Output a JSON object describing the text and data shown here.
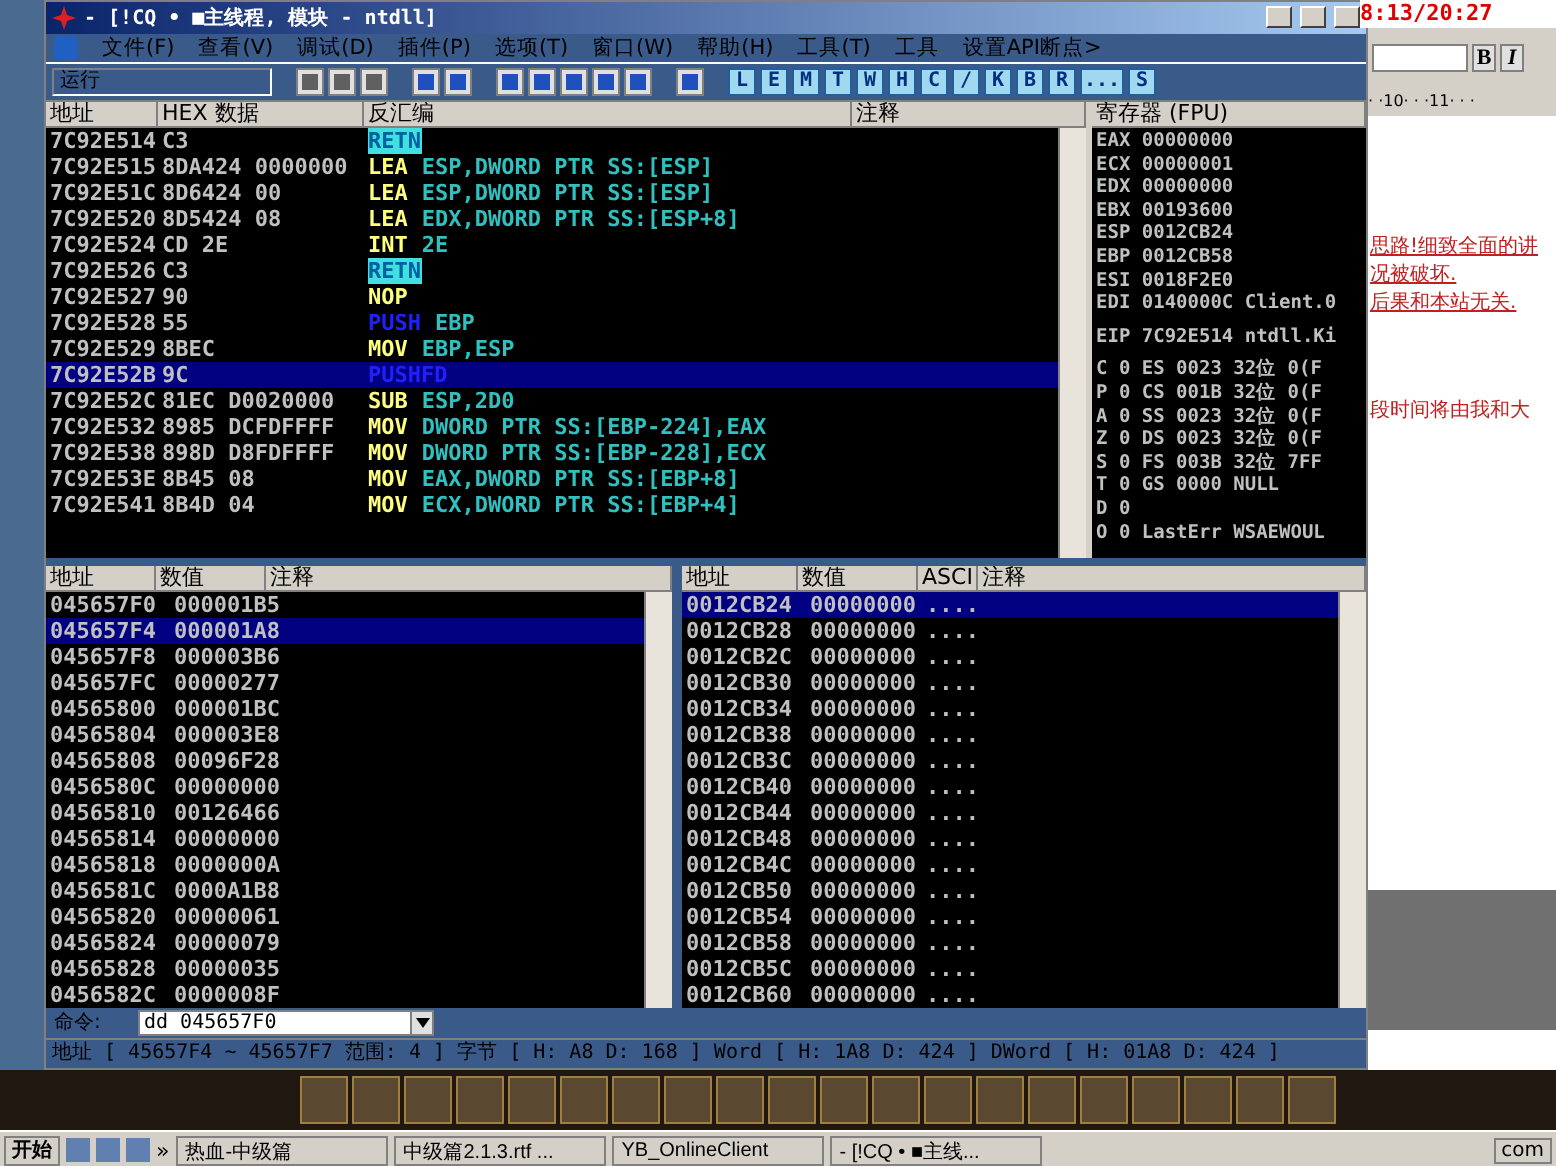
{
  "window": {
    "title": "- [!CQ • ■主线程, 模块 - ntdll]"
  },
  "menu": [
    "文件(F)",
    "查看(V)",
    "调试(D)",
    "插件(P)",
    "选项(T)",
    "窗口(W)",
    "帮助(H)",
    "工具(T)",
    "工具",
    "设置API断点>"
  ],
  "toolbar": {
    "status": "运行",
    "letters": [
      "L",
      "E",
      "M",
      "T",
      "W",
      "H",
      "C",
      "/",
      "K",
      "B",
      "R",
      "...",
      "S"
    ]
  },
  "disasm": {
    "columns": [
      "地址",
      "HEX 数据",
      "反汇编",
      "注释"
    ],
    "rows": [
      {
        "address": "7C92E514",
        "hex": "C3",
        "kind": "ret",
        "mnemonic": "RETN",
        "operands": "",
        "selected": false
      },
      {
        "address": "7C92E515",
        "hex": "8DA424 0000000",
        "kind": "op",
        "mnemonic": "LEA",
        "operands": "ESP,DWORD PTR SS:[ESP]",
        "selected": false
      },
      {
        "address": "7C92E51C",
        "hex": "8D6424 00",
        "kind": "op",
        "mnemonic": "LEA",
        "operands": "ESP,DWORD PTR SS:[ESP]",
        "selected": false
      },
      {
        "address": "7C92E520",
        "hex": "8D5424 08",
        "kind": "op",
        "mnemonic": "LEA",
        "operands": "EDX,DWORD PTR SS:[ESP+8]",
        "selected": false
      },
      {
        "address": "7C92E524",
        "hex": "CD 2E",
        "kind": "op",
        "mnemonic": "INT",
        "operands": "2E",
        "selected": false
      },
      {
        "address": "7C92E526",
        "hex": "C3",
        "kind": "ret",
        "mnemonic": "RETN",
        "operands": "",
        "selected": false
      },
      {
        "address": "7C92E527",
        "hex": "90",
        "kind": "op",
        "mnemonic": "NOP",
        "operands": "",
        "selected": false
      },
      {
        "address": "7C92E528",
        "hex": "55",
        "kind": "push",
        "mnemonic": "PUSH",
        "operands": "EBP",
        "selected": false
      },
      {
        "address": "7C92E529",
        "hex": "8BEC",
        "kind": "op",
        "mnemonic": "MOV",
        "operands": "EBP,ESP",
        "selected": false
      },
      {
        "address": "7C92E52B",
        "hex": "9C",
        "kind": "push",
        "mnemonic": "PUSHFD",
        "operands": "",
        "selected": true
      },
      {
        "address": "7C92E52C",
        "hex": "81EC D0020000",
        "kind": "op",
        "mnemonic": "SUB",
        "operands": "ESP,2D0",
        "selected": false
      },
      {
        "address": "7C92E532",
        "hex": "8985 DCFDFFFF",
        "kind": "op",
        "mnemonic": "MOV",
        "operands": "DWORD PTR SS:[EBP-224],EAX",
        "selected": false
      },
      {
        "address": "7C92E538",
        "hex": "898D D8FDFFFF",
        "kind": "op",
        "mnemonic": "MOV",
        "operands": "DWORD PTR SS:[EBP-228],ECX",
        "selected": false
      },
      {
        "address": "7C92E53E",
        "hex": "8B45 08",
        "kind": "op",
        "mnemonic": "MOV",
        "operands": "EAX,DWORD PTR SS:[EBP+8]",
        "selected": false
      },
      {
        "address": "7C92E541",
        "hex": "8B4D 04",
        "kind": "op",
        "mnemonic": "MOV",
        "operands": "ECX,DWORD PTR SS:[EBP+4]",
        "selected": false
      }
    ]
  },
  "registers": {
    "title": "寄存器 (FPU)",
    "groups": [
      [
        "EAX 00000000",
        "ECX 00000001",
        "EDX 00000000",
        "EBX 00193600",
        "ESP 0012CB24",
        "EBP 0012CB58",
        "ESI 0018F2E0",
        "EDI 0140000C Client.0"
      ],
      [
        "EIP 7C92E514 ntdll.Ki"
      ],
      [
        "C 0  ES 0023 32位 0(F",
        "P 0  CS 001B 32位 0(F",
        "A 0  SS 0023 32位 0(F",
        "Z 0  DS 0023 32位 0(F",
        "S 0  FS 003B 32位 7FF",
        "T 0  GS 0000 NULL",
        "D 0",
        "O 0  LastErr WSAEWOUL"
      ]
    ]
  },
  "dump": {
    "columns": [
      "地址",
      "数值",
      "注释"
    ],
    "rows": [
      {
        "address": "045657F0",
        "value": "000001B5",
        "selected": false
      },
      {
        "address": "045657F4",
        "value": "000001A8",
        "selected": true
      },
      {
        "address": "045657F8",
        "value": "000003B6",
        "selected": false
      },
      {
        "address": "045657FC",
        "value": "00000277",
        "selected": false
      },
      {
        "address": "04565800",
        "value": "000001BC",
        "selected": false
      },
      {
        "address": "04565804",
        "value": "000003E8",
        "selected": false
      },
      {
        "address": "04565808",
        "value": "00096F28",
        "selected": false
      },
      {
        "address": "0456580C",
        "value": "00000000",
        "selected": false
      },
      {
        "address": "04565810",
        "value": "00126466",
        "selected": false
      },
      {
        "address": "04565814",
        "value": "00000000",
        "selected": false
      },
      {
        "address": "04565818",
        "value": "0000000A",
        "selected": false
      },
      {
        "address": "0456581C",
        "value": "0000A1B8",
        "selected": false
      },
      {
        "address": "04565820",
        "value": "00000061",
        "selected": false
      },
      {
        "address": "04565824",
        "value": "00000079",
        "selected": false
      },
      {
        "address": "04565828",
        "value": "00000035",
        "selected": false
      },
      {
        "address": "0456582C",
        "value": "0000008F",
        "selected": false
      }
    ]
  },
  "stack": {
    "columns": [
      "地址",
      "数值",
      "ASCI",
      "注释"
    ],
    "rows": [
      {
        "address": "0012CB24",
        "value": "00000000",
        "ascii": "....",
        "selected": true
      },
      {
        "address": "0012CB28",
        "value": "00000000",
        "ascii": "....",
        "selected": false
      },
      {
        "address": "0012CB2C",
        "value": "00000000",
        "ascii": "....",
        "selected": false
      },
      {
        "address": "0012CB30",
        "value": "00000000",
        "ascii": "....",
        "selected": false
      },
      {
        "address": "0012CB34",
        "value": "00000000",
        "ascii": "....",
        "selected": false
      },
      {
        "address": "0012CB38",
        "value": "00000000",
        "ascii": "....",
        "selected": false
      },
      {
        "address": "0012CB3C",
        "value": "00000000",
        "ascii": "....",
        "selected": false
      },
      {
        "address": "0012CB40",
        "value": "00000000",
        "ascii": "....",
        "selected": false
      },
      {
        "address": "0012CB44",
        "value": "00000000",
        "ascii": "....",
        "selected": false
      },
      {
        "address": "0012CB48",
        "value": "00000000",
        "ascii": "....",
        "selected": false
      },
      {
        "address": "0012CB4C",
        "value": "00000000",
        "ascii": "....",
        "selected": false
      },
      {
        "address": "0012CB50",
        "value": "00000000",
        "ascii": "....",
        "selected": false
      },
      {
        "address": "0012CB54",
        "value": "00000000",
        "ascii": "....",
        "selected": false
      },
      {
        "address": "0012CB58",
        "value": "00000000",
        "ascii": "....",
        "selected": false
      },
      {
        "address": "0012CB5C",
        "value": "00000000",
        "ascii": "....",
        "selected": false
      },
      {
        "address": "0012CB60",
        "value": "00000000",
        "ascii": "....",
        "selected": false
      }
    ]
  },
  "command": {
    "label": "命令:",
    "value": "dd 045657F0"
  },
  "status_bar": "地址 [ 45657F4 ~ 45657F7 范围: 4 ] 字节 [ H: A8 D: 168 ] Word [ H: 1A8 D: 424 ] DWord [ H: 01A8 D: 424 ]",
  "document": {
    "clock": "8:13/20:27",
    "format_buttons": [
      "B",
      "I"
    ],
    "ruler": "· ·10· · ·11· · ·",
    "lines": [
      "思路!细致全面的讲",
      "况被破坏.",
      "后果和本站无关.",
      "段时间将由我和大"
    ]
  },
  "taskbar": {
    "start": "开始",
    "more": "»",
    "tasks": [
      "热血-中级篇",
      "中级篇2.1.3.rtf ...",
      "YB_OnlineClient",
      "- [!CQ • ■主线..."
    ],
    "tray": "com"
  }
}
